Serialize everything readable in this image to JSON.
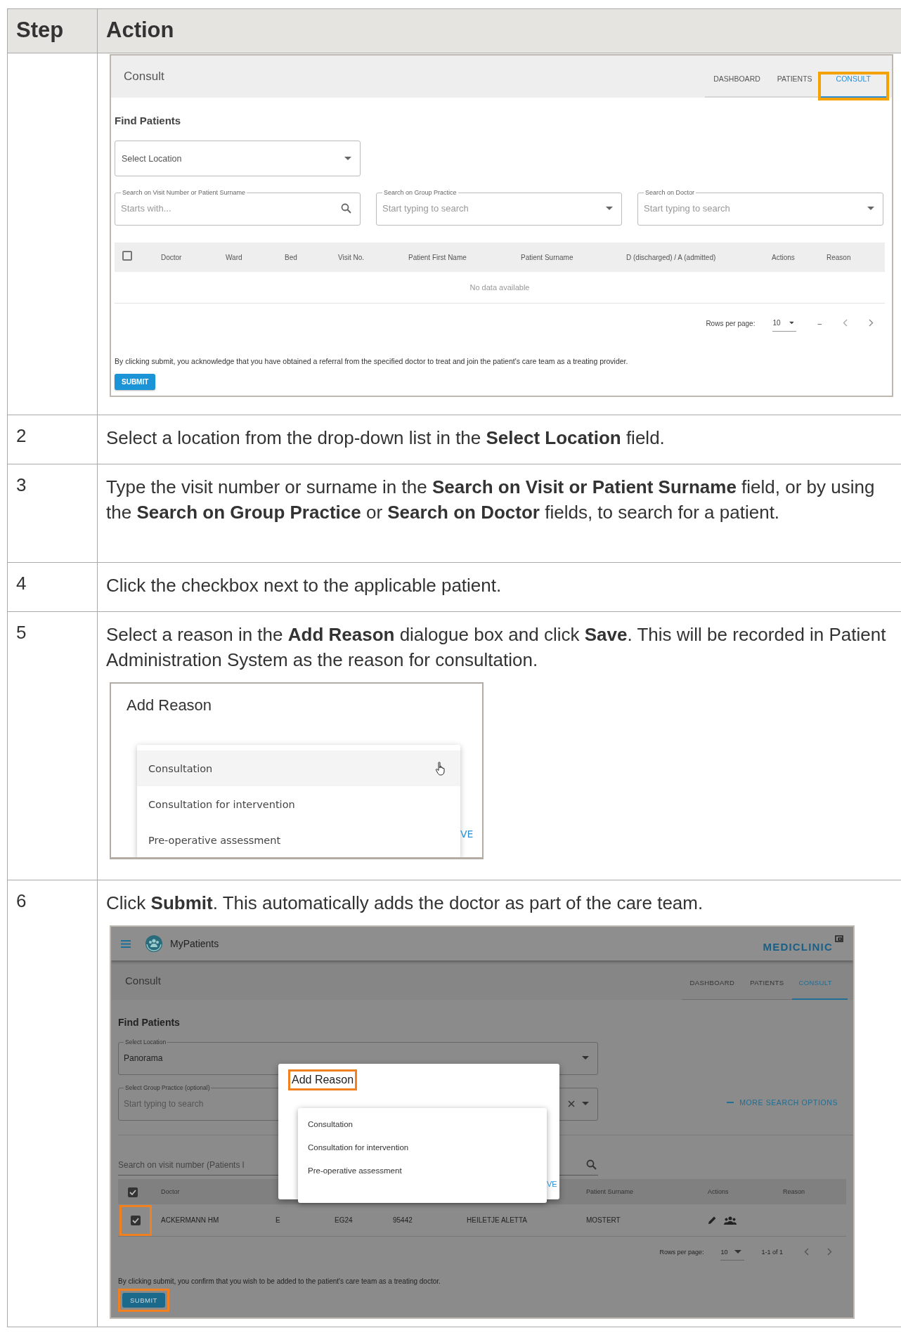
{
  "table": {
    "columns": [
      "Step",
      "Action"
    ],
    "rows": [
      {
        "screenshot": {
          "kind": "find_patients",
          "title": "Consult",
          "tabs": [
            {
              "label": "DASHBOARD",
              "selected": false,
              "highlighted": false
            },
            {
              "label": "PATIENTS",
              "selected": false,
              "highlighted": false
            },
            {
              "label": "CONSULT",
              "selected": true,
              "highlighted": true
            }
          ],
          "heading": "Find Patients",
          "location_field": {
            "placeholder": "Select Location"
          },
          "search_fields": [
            {
              "kind": "search",
              "label": "Search on Visit Number or Patient Surname",
              "placeholder": "Starts with..."
            },
            {
              "kind": "dropdown",
              "label": "Search on Group Practice",
              "placeholder": "Start typing to search"
            },
            {
              "kind": "dropdown",
              "label": "Search on Doctor",
              "placeholder": "Start typing to search"
            }
          ],
          "select_all_checked": false,
          "columns": [
            "Doctor",
            "Ward",
            "Bed",
            "Visit No.",
            "Patient First Name",
            "Patient Surname",
            "D (discharged) / A (admitted)",
            "Actions",
            "Reason"
          ],
          "empty_text": "No data available",
          "rows_per_page_label": "Rows per page:",
          "rows_per_page": "10",
          "range": "–",
          "note": "By clicking submit, you acknowledge that you have obtained a referral from the specified doctor to treat and join the patient's care team as a treating provider.",
          "submit": {
            "label": "SUBMIT",
            "highlighted": false
          }
        }
      },
      {
        "step": "2",
        "instruction": "Select a location from the drop-down list in the **Select Location** field."
      },
      {
        "step": "3",
        "instruction": "Type the visit number or surname in the **Search on Visit or Patient Surname** field, or by using the **Search on Group Practice** or **Search on Doctor** fields, to search for a patient."
      },
      {
        "step": "4",
        "instruction": "Click the checkbox next to the applicable patient."
      },
      {
        "step": "5",
        "instruction": "Select a reason in the **Add Reason** dialogue box and click **Save**.  This will be recorded in Patient Administration System as the reason for consultation.",
        "screenshot": {
          "kind": "reason_dialog",
          "title": "Add Reason",
          "options": [
            {
              "label": "Consultation",
              "hovered": true
            },
            {
              "label": "Consultation for intervention",
              "hovered": false
            },
            {
              "label": "Pre-operative assessment",
              "hovered": false
            }
          ],
          "save_fragment": "VE"
        }
      },
      {
        "step": "6",
        "instruction": "Click **Submit**.  This automatically adds the doctor as part of the care team.",
        "screenshot": {
          "kind": "find_patients_dialog",
          "app_name": "MyPatients",
          "brand": "MEDICLINIC",
          "title": "Consult",
          "tabs": [
            {
              "label": "DASHBOARD",
              "selected": false
            },
            {
              "label": "PATIENTS",
              "selected": false
            },
            {
              "label": "CONSULT",
              "selected": true
            }
          ],
          "heading": "Find Patients",
          "location_field": {
            "label": "Select Location",
            "value": "Panorama"
          },
          "group_field": {
            "label": "Select Group Practice (optional)",
            "placeholder": "Start typing to search"
          },
          "more_options": "MORE SEARCH OPTIONS",
          "search_field": {
            "placeholder": "Search on visit number (Patients l"
          },
          "select_all_checked": true,
          "columns": [
            "Doctor",
            "",
            "",
            "",
            "",
            "Patient Surname",
            "Actions",
            "Reason"
          ],
          "rows": [
            {
              "checked": true,
              "highlighted": true,
              "cells": [
                "ACKERMANN HM",
                "E",
                "EG24",
                "95442",
                "HEILETJE ALETTA",
                "MOSTERT"
              ]
            }
          ],
          "rows_per_page_label": "Rows per page:",
          "rows_per_page": "10",
          "range": "1-1 of 1",
          "note": "By clicking submit, you confirm that you wish to be added to the patient's care team as a treating doctor.",
          "submit": {
            "label": "SUBMIT",
            "highlighted": true
          },
          "dialog": {
            "title": "Add Reason",
            "title_highlighted": true,
            "options": [
              {
                "label": "Consultation",
                "hovered": false
              },
              {
                "label": "Consultation for intervention",
                "hovered": false
              },
              {
                "label": "Pre-operative assessment",
                "hovered": false
              }
            ],
            "save_fragment": "VE"
          }
        }
      }
    ]
  }
}
